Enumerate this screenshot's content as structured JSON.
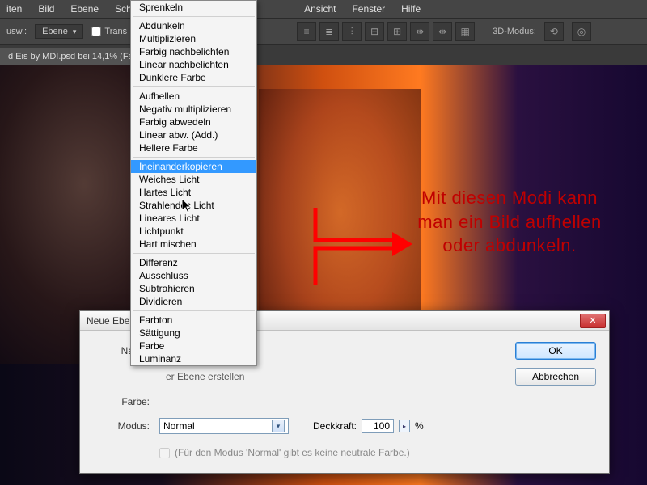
{
  "menubar": [
    "iten",
    "Bild",
    "Ebene",
    "Schrift",
    "Ansicht",
    "Fenster",
    "Hilfe"
  ],
  "optionbar": {
    "label_left": "usw.:",
    "combo": "Ebene",
    "checkbox": "Trans",
    "mode3d": "3D-Modus:"
  },
  "doc_tab": "d Eis by MDI.psd bei 14,1% (Fa",
  "dropdown": {
    "groups": [
      [
        "Sprenkeln"
      ],
      [
        "Abdunkeln",
        "Multiplizieren",
        "Farbig nachbelichten",
        "Linear nachbelichten",
        "Dunklere Farbe"
      ],
      [
        "Aufhellen",
        "Negativ multiplizieren",
        "Farbig abwedeln",
        "Linear abw. (Add.)",
        "Hellere Farbe"
      ],
      [
        "Ineinanderkopieren",
        "Weiches Licht",
        "Hartes Licht",
        "Strahlendes Licht",
        "Lineares Licht",
        "Lichtpunkt",
        "Hart mischen"
      ],
      [
        "Differenz",
        "Ausschluss",
        "Subtrahieren",
        "Dividieren"
      ],
      [
        "Farbton",
        "Sättigung",
        "Farbe",
        "Luminanz"
      ]
    ],
    "highlighted": "Ineinanderkopieren"
  },
  "annotation": "Mit diesen Modi kann man ein Bild aufhellen oder abdunkeln.",
  "dialog": {
    "title": "Neue Ebene",
    "name_label": "Name:",
    "name_value": "",
    "prev_text": "er Ebene erstellen",
    "color_label": "Farbe:",
    "mode_label": "Modus:",
    "mode_value": "Normal",
    "opacity_label": "Deckkraft:",
    "opacity_value": "100",
    "opacity_suffix": "%",
    "neutral_text": "(Für den Modus 'Normal' gibt es keine neutrale Farbe.)",
    "ok": "OK",
    "cancel": "Abbrechen"
  }
}
